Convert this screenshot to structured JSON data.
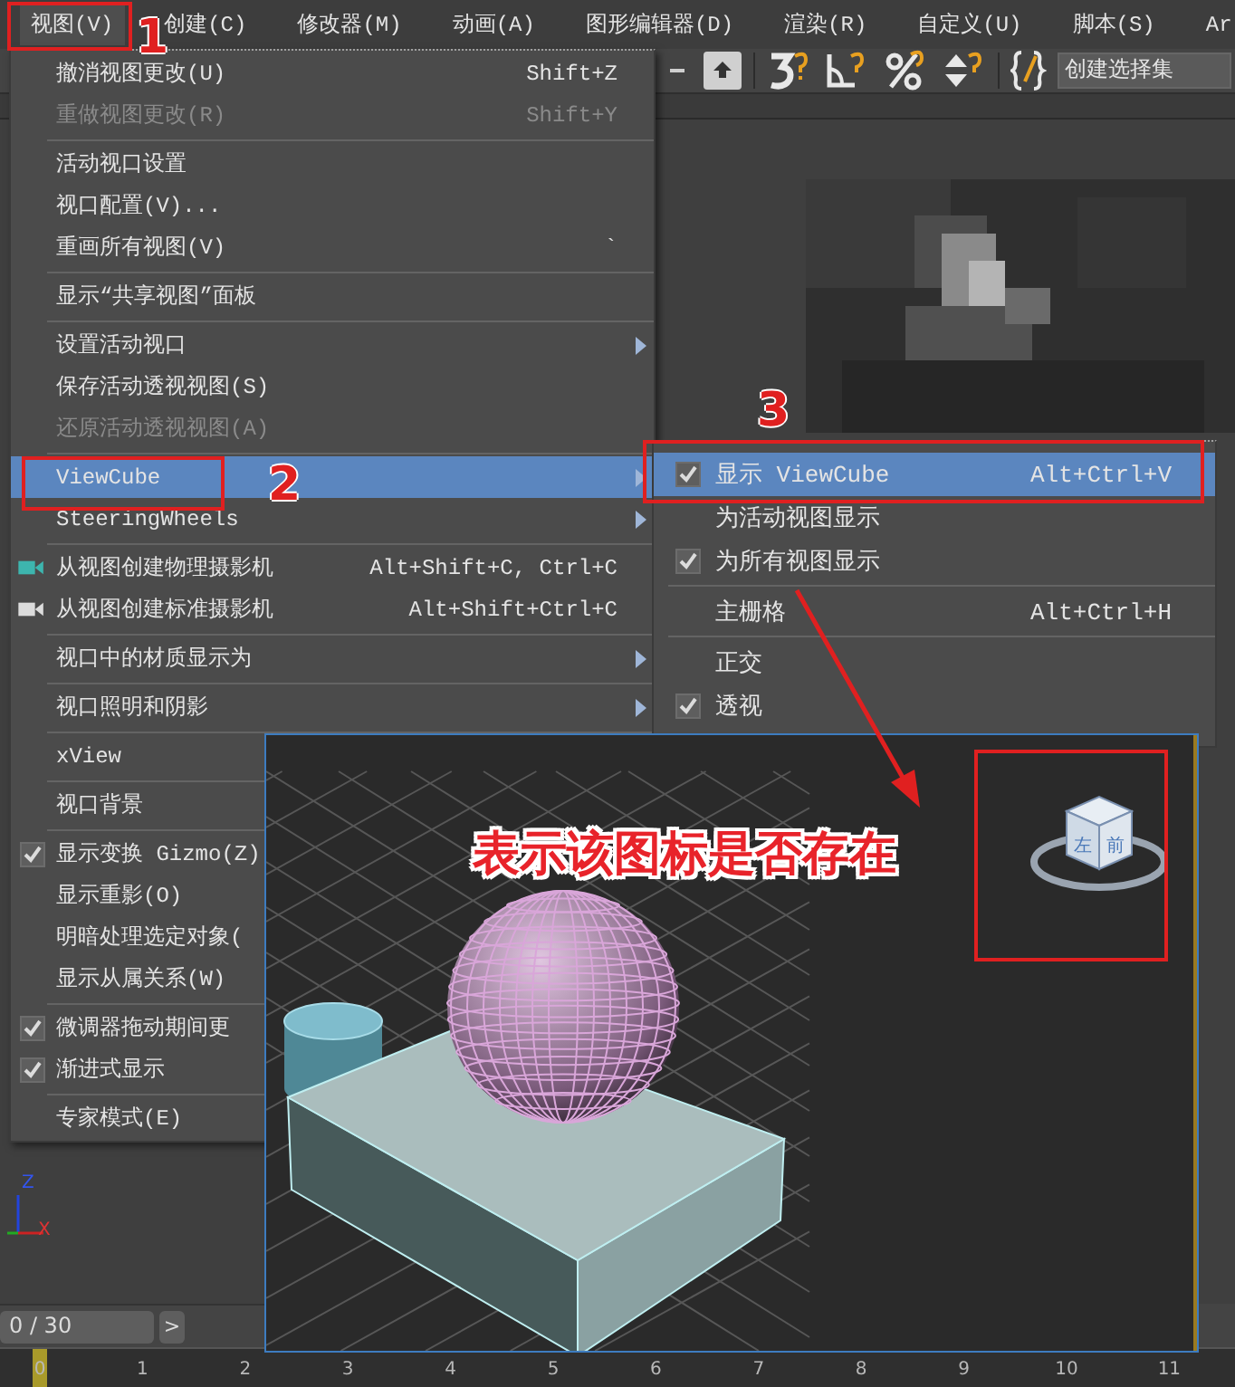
{
  "menubar": [
    {
      "label": "视图(V)",
      "selected": true
    },
    {
      "label": "创建(C)",
      "selected": false
    },
    {
      "label": "修改器(M)",
      "selected": false
    },
    {
      "label": "动画(A)",
      "selected": false
    },
    {
      "label": "图形编辑器(D)",
      "selected": false
    },
    {
      "label": "渲染(R)",
      "selected": false
    },
    {
      "label": "自定义(U)",
      "selected": false
    },
    {
      "label": "脚本(S)",
      "selected": false
    },
    {
      "label": "Ar",
      "selected": false
    }
  ],
  "toolbar": {
    "selection_set": {
      "placeholder": "创建选择集"
    }
  },
  "view_menu": {
    "items": [
      {
        "kind": "item",
        "label": "撤消视图更改(U)",
        "shortcut": "Shift+Z",
        "disabled": false,
        "checked": false,
        "selected": false,
        "submenu": false
      },
      {
        "kind": "item",
        "label": "重做视图更改(R)",
        "shortcut": "Shift+Y",
        "disabled": true,
        "checked": false,
        "selected": false,
        "submenu": false
      },
      {
        "kind": "separator"
      },
      {
        "kind": "item",
        "label": "活动视口设置",
        "disabled": false,
        "checked": false,
        "selected": false,
        "submenu": false
      },
      {
        "kind": "item",
        "label": "视口配置(V)...",
        "disabled": false,
        "checked": false,
        "selected": false,
        "submenu": false
      },
      {
        "kind": "item",
        "label": "重画所有视图(V)",
        "shortcut": "`",
        "disabled": false,
        "checked": false,
        "selected": false,
        "submenu": false
      },
      {
        "kind": "separator"
      },
      {
        "kind": "item",
        "label": "显示“共享视图”面板",
        "disabled": false,
        "checked": false,
        "selected": false,
        "submenu": false
      },
      {
        "kind": "separator"
      },
      {
        "kind": "item",
        "label": "设置活动视口",
        "disabled": false,
        "checked": false,
        "selected": false,
        "submenu": true
      },
      {
        "kind": "item",
        "label": "保存活动透视视图(S)",
        "disabled": false,
        "checked": false,
        "selected": false,
        "submenu": false
      },
      {
        "kind": "item",
        "label": "还原活动透视视图(A)",
        "disabled": true,
        "checked": false,
        "selected": false,
        "submenu": false
      },
      {
        "kind": "separator"
      },
      {
        "kind": "item",
        "label": "ViewCube",
        "disabled": false,
        "checked": false,
        "selected": true,
        "submenu": true
      },
      {
        "kind": "item",
        "label": "SteeringWheels",
        "disabled": false,
        "checked": false,
        "selected": false,
        "submenu": true
      },
      {
        "kind": "separator"
      },
      {
        "kind": "camera",
        "color": "#3db5ae",
        "label": "从视图创建物理摄影机",
        "shortcut": "Alt+Shift+C, Ctrl+C",
        "disabled": false,
        "checked": false,
        "selected": false,
        "submenu": false
      },
      {
        "kind": "camera",
        "color": "#dcdcdc",
        "label": "从视图创建标准摄影机",
        "shortcut": "Alt+Shift+Ctrl+C",
        "disabled": false,
        "checked": false,
        "selected": false,
        "submenu": false
      },
      {
        "kind": "separator"
      },
      {
        "kind": "item",
        "label": "视口中的材质显示为",
        "disabled": false,
        "checked": false,
        "selected": false,
        "submenu": true
      },
      {
        "kind": "separator"
      },
      {
        "kind": "item",
        "label": "视口照明和阴影",
        "disabled": false,
        "checked": false,
        "selected": false,
        "submenu": true
      },
      {
        "kind": "separator"
      },
      {
        "kind": "item",
        "label": "xView",
        "disabled": false,
        "checked": false,
        "selected": false,
        "submenu": false
      },
      {
        "kind": "separator"
      },
      {
        "kind": "item",
        "label": "视口背景",
        "disabled": false,
        "checked": false,
        "selected": false,
        "submenu": false
      },
      {
        "kind": "separator"
      },
      {
        "kind": "item",
        "label": "显示变换 Gizmo(Z)",
        "disabled": false,
        "checked": true,
        "selected": false,
        "submenu": false
      },
      {
        "kind": "item",
        "label": "显示重影(O)",
        "disabled": false,
        "checked": false,
        "selected": false,
        "submenu": false
      },
      {
        "kind": "item",
        "label": "明暗处理选定对象(",
        "disabled": false,
        "checked": false,
        "selected": false,
        "submenu": false
      },
      {
        "kind": "item",
        "label": "显示从属关系(W)",
        "disabled": false,
        "checked": false,
        "selected": false,
        "submenu": false
      },
      {
        "kind": "separator"
      },
      {
        "kind": "item",
        "label": "微调器拖动期间更",
        "disabled": false,
        "checked": true,
        "selected": false,
        "submenu": false
      },
      {
        "kind": "item",
        "label": "渐进式显示",
        "disabled": false,
        "checked": true,
        "selected": false,
        "submenu": false
      },
      {
        "kind": "separator"
      },
      {
        "kind": "item",
        "label": "专家模式(E)",
        "disabled": false,
        "checked": false,
        "selected": false,
        "submenu": false
      }
    ]
  },
  "viewcube_submenu": {
    "items": [
      {
        "kind": "item",
        "label": "显示 ViewCube",
        "shortcut": "Alt+Ctrl+V",
        "checked": true,
        "selected": true
      },
      {
        "kind": "item",
        "label": "为活动视图显示",
        "checked": false,
        "selected": false
      },
      {
        "kind": "item",
        "label": "为所有视图显示",
        "checked": true,
        "selected": false
      },
      {
        "kind": "separator"
      },
      {
        "kind": "item",
        "label": "主栅格",
        "shortcut": "Alt+Ctrl+H",
        "checked": false,
        "selected": false
      },
      {
        "kind": "separator"
      },
      {
        "kind": "item",
        "label": "正交",
        "checked": false,
        "selected": false
      },
      {
        "kind": "item",
        "label": "透视",
        "checked": true,
        "selected": false
      }
    ]
  },
  "inset": {
    "caption": "表示该图标是否存在",
    "viewcube_faces": [
      "左",
      "前"
    ]
  },
  "axis_tripod": {
    "labels": [
      "Z",
      "X"
    ]
  },
  "time_slider": {
    "value": "0 / 30",
    "level": 0,
    "next": ">"
  },
  "timeline": {
    "ticks": [
      "0",
      "1",
      "2",
      "3",
      "4",
      "5",
      "6",
      "7",
      "8",
      "9",
      "10",
      "11"
    ],
    "level": 0
  },
  "annotations": {
    "markers": [
      "1",
      "2",
      "3"
    ]
  }
}
